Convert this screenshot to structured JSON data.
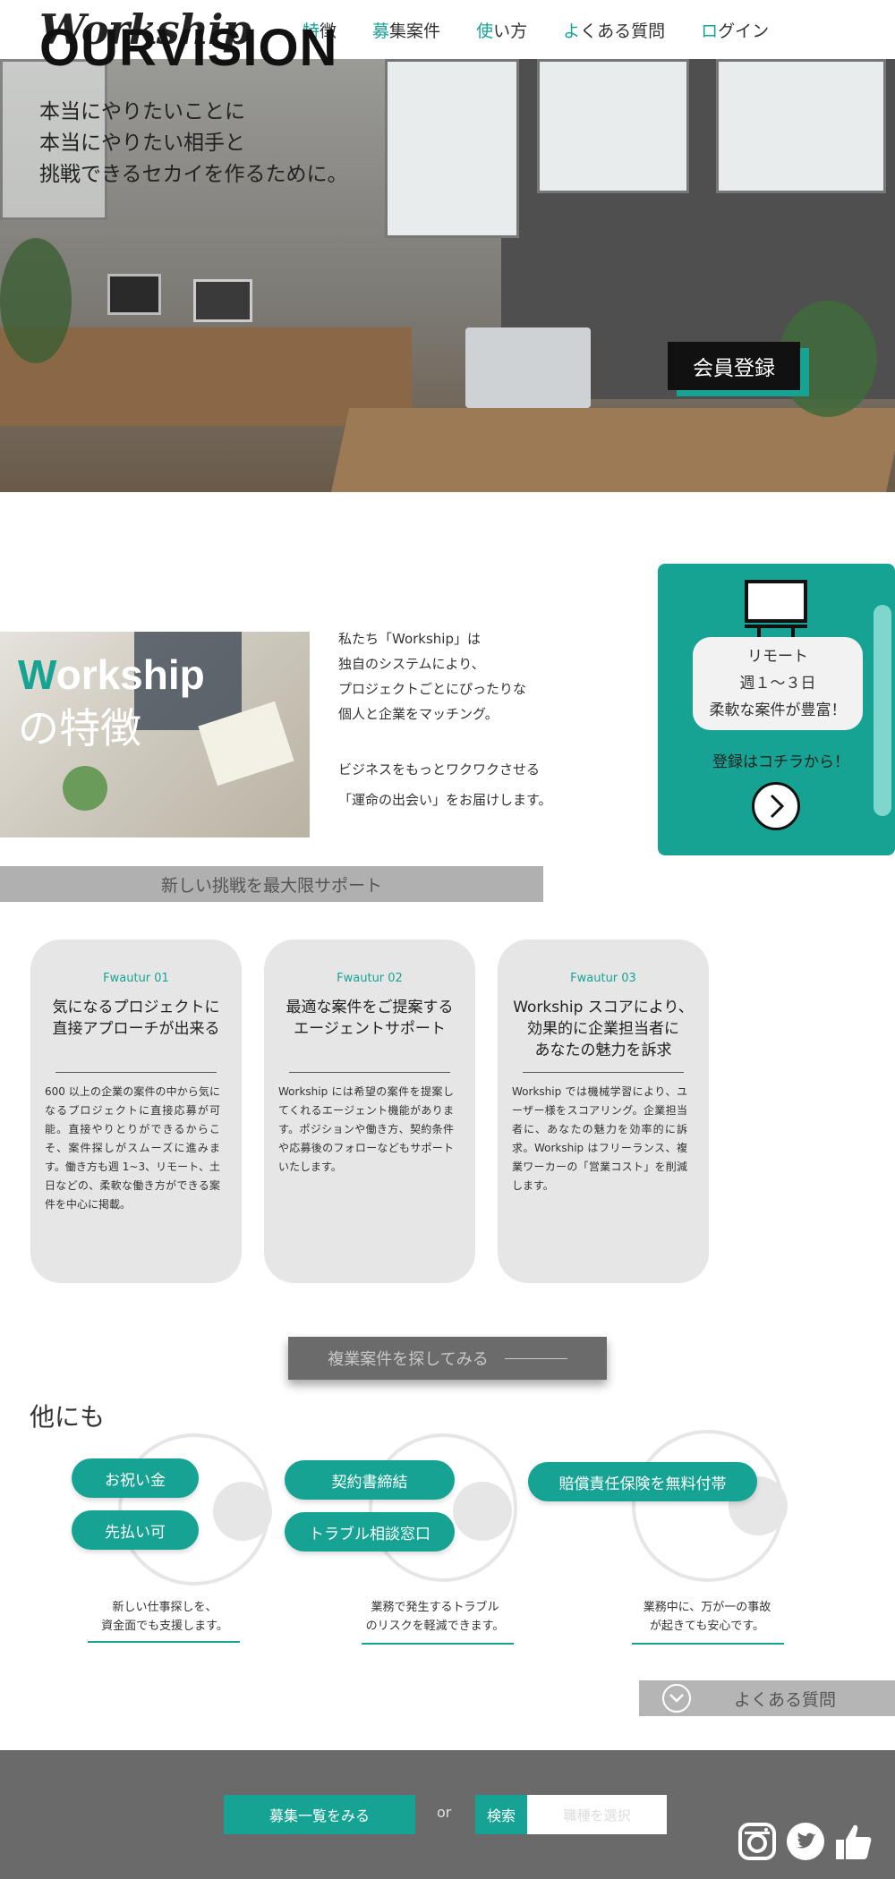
{
  "header": {
    "logo": "Workship",
    "nav": [
      {
        "first": "特",
        "rest": "徴"
      },
      {
        "first": "募",
        "rest": "集案件"
      },
      {
        "first": "使",
        "rest": "い方"
      },
      {
        "first": "よ",
        "rest": "くある質問"
      },
      {
        "first": "ロ",
        "rest": "グイン"
      }
    ]
  },
  "hero": {
    "title": "OURVISION",
    "lines": [
      "本当にやりたいことに",
      "本当にやりたい相手と",
      "挑戦できるセカイを作るために。"
    ],
    "join_button": "会員登録"
  },
  "intro": {
    "title_first": "W",
    "title_rest": "orkship",
    "subtitle": "の特徴",
    "paragraph1": [
      "私たち「Workship」は",
      "独自のシステムにより、",
      "プロジェクトごとにぴったりな",
      "個人と企業をマッチング。"
    ],
    "paragraph2": [
      "ビジネスをもっとワクワクさせる",
      "「運命の出会い」をお届けします。"
    ]
  },
  "side_card": {
    "bubble": [
      "リモート",
      "週１〜３日",
      "柔軟な案件が豊富！"
    ],
    "cta": "登録はコチラから！",
    "icon": "monitor-icon"
  },
  "support_bar": "新しい挑戦を最大限サポート",
  "features": [
    {
      "num": "Fwautur 01",
      "head": [
        "気になるプロジェクトに",
        "直接アプローチが出来る"
      ],
      "body": "600 以上の企業の案件の中から気になるプロジェクトに直接応募が可能。直接やりとりができるからこそ、案件探しがスムーズに進みます。働き方も週 1~3、リモート、土日などの、柔軟な働き方ができる案件を中心に掲載。"
    },
    {
      "num": "Fwautur 02",
      "head": [
        "最適な案件をご提案する",
        "エージェントサポート"
      ],
      "body": "Workship には希望の案件を提案してくれるエージェント機能があります。ポジションや働き方、契約条件や応募後のフォローなどもサポートいたします。"
    },
    {
      "num": "Fwautur 03",
      "head": [
        "Workship スコアにより、",
        "効果的に企業担当者に",
        "あなたの魅力を訴求"
      ],
      "body": "Workship では機械学習により、ユーザー様をスコアリング。企業担当者に、あなたの魅力を効率的に訴求。Workship はフリーランス、複業ワーカーの「営業コスト」を削減します。"
    }
  ],
  "browse_button": "複業案件を探してみる",
  "others": {
    "title": "他にも",
    "pills": [
      "お祝い金",
      "先払い可",
      "契約書締結",
      "トラブル相談窓口",
      "賠償責任保険を無料付帯"
    ],
    "captions": [
      [
        "新しい仕事探しを、",
        "資金面でも支援します。"
      ],
      [
        "業務で発生するトラブル",
        "のリスクを軽減できます。"
      ],
      [
        "業務中に、万が一の事故",
        "が起きても安心です。"
      ]
    ]
  },
  "faq": {
    "label": "よくある質問",
    "icon": "chevron-down-icon"
  },
  "footer": {
    "list_button": "募集一覧をみる",
    "or": "or",
    "search_button": "検索",
    "search_placeholder": "職種を選択",
    "social": [
      "instagram-icon",
      "twitter-icon",
      "thumbs-up-icon"
    ]
  },
  "colors": {
    "accent": "#16a394",
    "footer": "#6a6a6a",
    "card": "#e6e6e6"
  }
}
